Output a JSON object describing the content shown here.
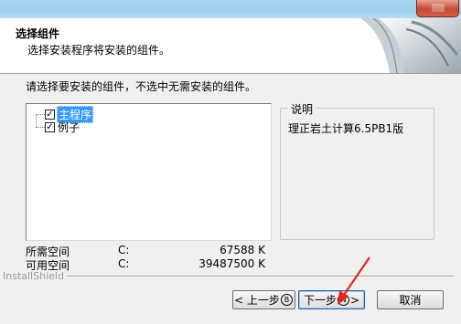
{
  "header": {
    "title": "选择组件",
    "subtitle": "选择安装程序将安装的组件。"
  },
  "prompt": "请选择要安装的组件，不选中无需安装的组件。",
  "components": [
    {
      "label": "主程序",
      "checked": true,
      "selected": true
    },
    {
      "label": "例子",
      "checked": true,
      "selected": false
    }
  ],
  "description": {
    "title": "说明",
    "text": "理正岩土计算6.5PB1版"
  },
  "space": {
    "required_label": "所需空间",
    "required_drive": "C:",
    "required_value": "67588 K",
    "available_label": "可用空间",
    "available_drive": "C:",
    "available_value": "39487500 K"
  },
  "brand": "InstallShield",
  "buttons": {
    "back": {
      "label": "< 上一步",
      "mnemonic": "B"
    },
    "next": {
      "label": "下一步",
      "mnemonic": "N",
      "suffix": ">"
    },
    "cancel": "取消"
  },
  "colors": {
    "selection": "#3399ff",
    "annotation_arrow": "#e3261b"
  }
}
